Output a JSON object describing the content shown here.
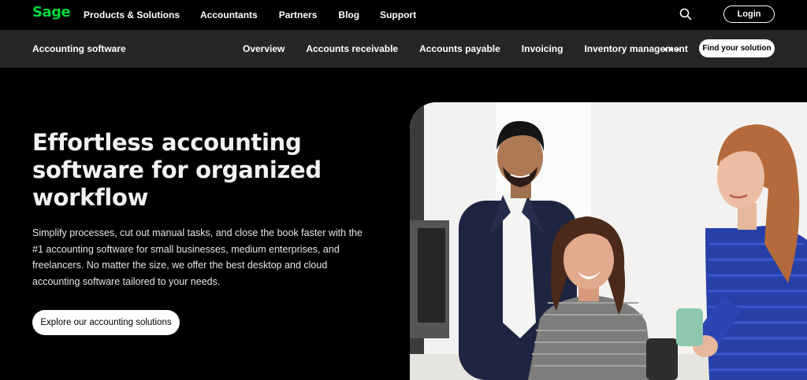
{
  "brand": {
    "logo_text": "Sage",
    "logo_color": "#00d639"
  },
  "top_nav": {
    "links": [
      "Products & Solutions",
      "Accountants",
      "Partners",
      "Blog",
      "Support"
    ],
    "search_icon": "search-icon",
    "login_label": "Login"
  },
  "sub_nav": {
    "title": "Accounting software",
    "links": [
      "Overview",
      "Accounts receivable",
      "Accounts payable",
      "Invoicing",
      "Inventory management"
    ],
    "more_icon": "more-horizontal-icon",
    "find_label": "Find your solution"
  },
  "hero": {
    "title_lines": [
      "Effortless accounting",
      "software for organized",
      "workflow"
    ],
    "text_lines": [
      "Simplify processes, cut out manual tasks, and close the book faster with the",
      "#1 accounting software for small businesses, medium enterprises, and",
      "freelancers. No matter the size, we offer the best desktop and cloud",
      "accounting software tailored to your needs."
    ],
    "cta_label": "Explore our accounting solutions"
  }
}
